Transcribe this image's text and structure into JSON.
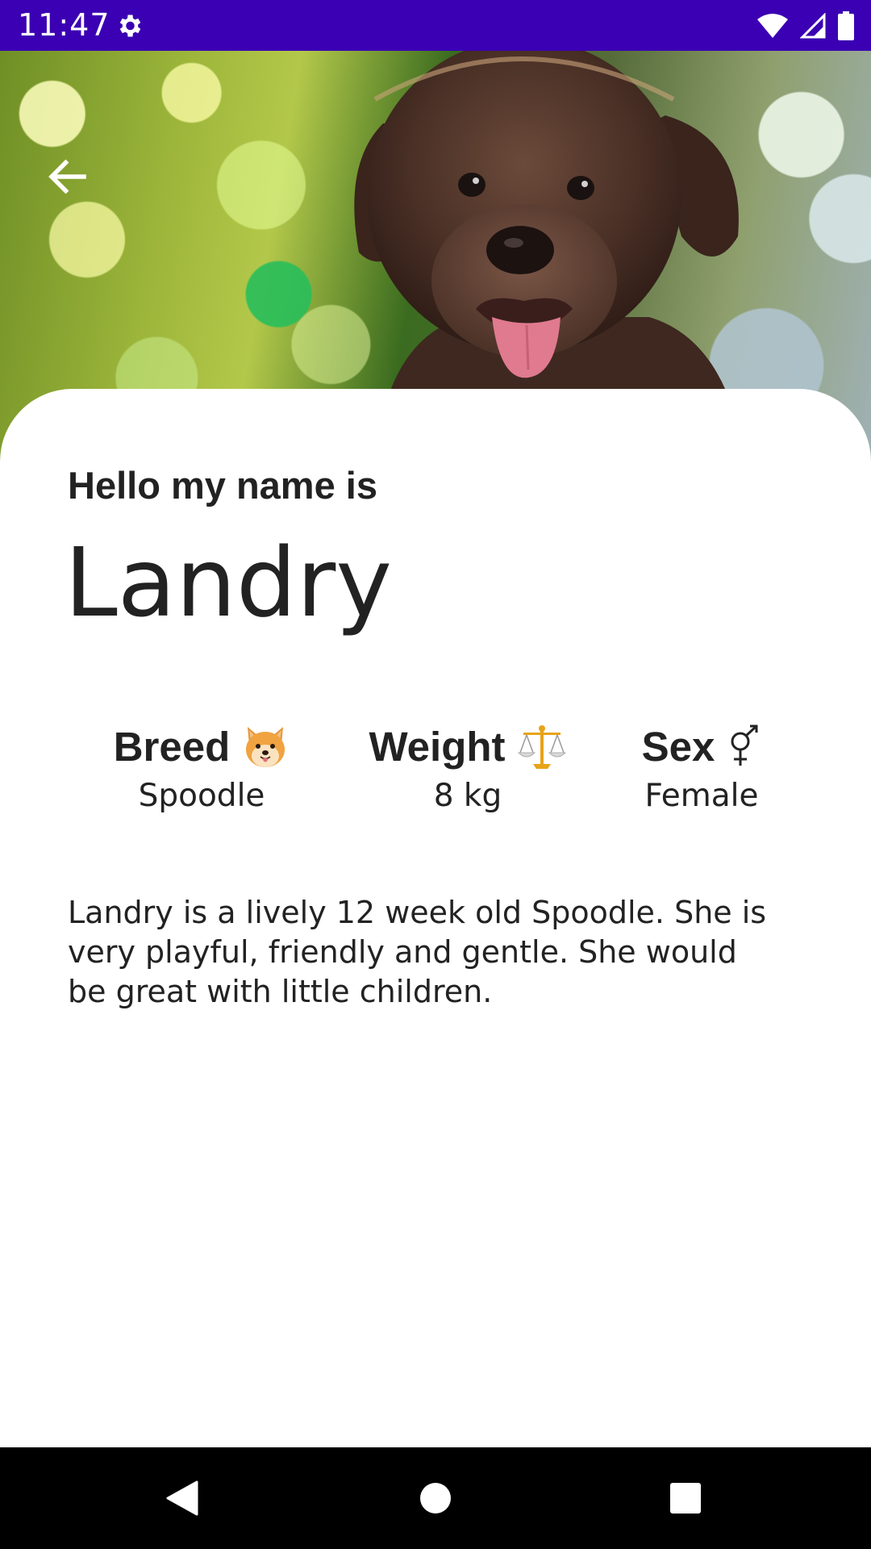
{
  "status_bar": {
    "time": "11:47",
    "background_color": "#3b00b3",
    "icons": [
      "settings-gear-icon",
      "wifi-icon",
      "cellular-signal-icon",
      "battery-icon"
    ]
  },
  "hero": {
    "image_subject": "brown puppy on blurred green bokeh background",
    "back_icon": "arrow-left-icon"
  },
  "profile": {
    "greeting": "Hello my name is",
    "name": "Landry"
  },
  "stats": [
    {
      "label": "Breed",
      "value": "Spoodle",
      "icon": "dog-face-emoji"
    },
    {
      "label": "Weight",
      "value": "8 kg",
      "icon": "balance-scale-emoji"
    },
    {
      "label": "Sex",
      "value": "Female",
      "icon": "male-female-symbol"
    }
  ],
  "description": "Landry is a lively 12 week old Spoodle. She is very playful, friendly and gentle. She would be great with little children.",
  "nav_bar": {
    "buttons": [
      "nav-back-icon",
      "nav-home-icon",
      "nav-recents-icon"
    ],
    "background_color": "#000000"
  }
}
